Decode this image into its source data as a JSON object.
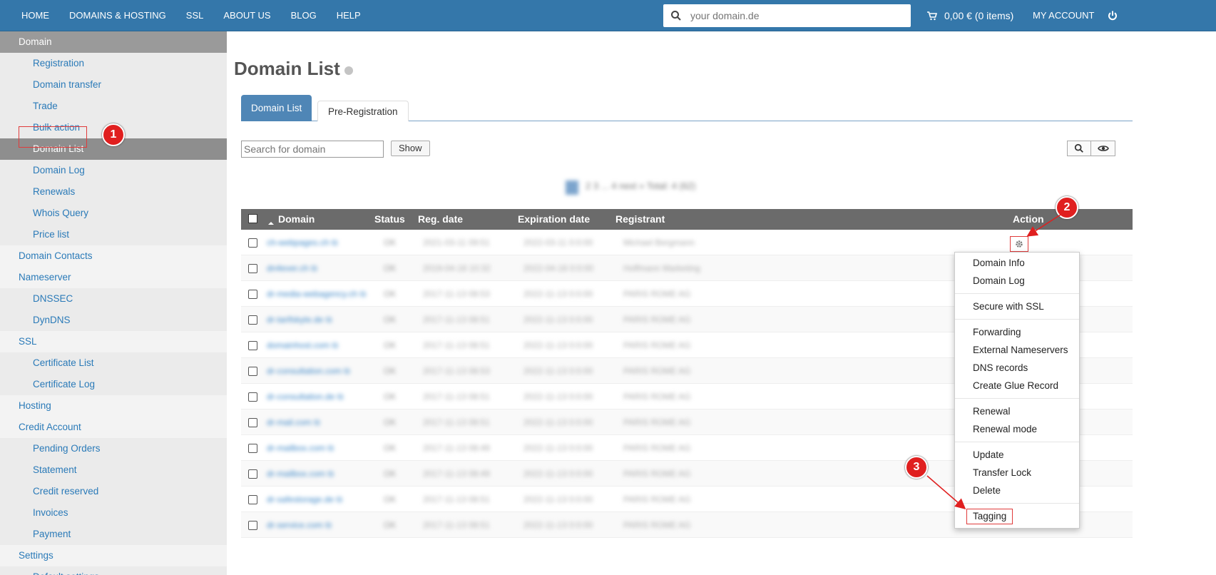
{
  "nav": {
    "items": [
      "HOME",
      "DOMAINS & HOSTING",
      "SSL",
      "ABOUT US",
      "BLOG",
      "HELP"
    ],
    "search_placeholder": "your domain.de",
    "cart": "0,00 € (0 items)",
    "my_account": "MY ACCOUNT"
  },
  "sidebar": {
    "items": [
      {
        "label": "Domain",
        "level": 1,
        "state": "head"
      },
      {
        "label": "Registration",
        "level": 2
      },
      {
        "label": "Domain transfer",
        "level": 2
      },
      {
        "label": "Trade",
        "level": 2
      },
      {
        "label": "Bulk action",
        "level": 2
      },
      {
        "label": "Domain List",
        "level": 2,
        "state": "active"
      },
      {
        "label": "Domain Log",
        "level": 2
      },
      {
        "label": "Renewals",
        "level": 2
      },
      {
        "label": "Whois Query",
        "level": 2
      },
      {
        "label": "Price list",
        "level": 2
      },
      {
        "label": "Domain Contacts",
        "level": 1
      },
      {
        "label": "Nameserver",
        "level": 1
      },
      {
        "label": "DNSSEC",
        "level": 2
      },
      {
        "label": "DynDNS",
        "level": 2
      },
      {
        "label": "SSL",
        "level": 1
      },
      {
        "label": "Certificate List",
        "level": 2
      },
      {
        "label": "Certificate Log",
        "level": 2
      },
      {
        "label": "Hosting",
        "level": 1
      },
      {
        "label": "Credit Account",
        "level": 1
      },
      {
        "label": "Pending Orders",
        "level": 2
      },
      {
        "label": "Statement",
        "level": 2
      },
      {
        "label": "Credit reserved",
        "level": 2
      },
      {
        "label": "Invoices",
        "level": 2
      },
      {
        "label": "Payment",
        "level": 2
      },
      {
        "label": "Settings",
        "level": 1
      },
      {
        "label": "Default settings",
        "level": 2
      }
    ]
  },
  "page": {
    "title": "Domain List",
    "tabs": [
      "Domain List",
      "Pre-Registration"
    ],
    "search_placeholder": "Search for domain",
    "show_label": "Show",
    "pager_text": "2 3 ... 4 next » Total: 4 (62)"
  },
  "table": {
    "headers": {
      "domain": "Domain",
      "status": "Status",
      "reg_date": "Reg. date",
      "exp_date": "Expiration date",
      "registrant": "Registrant",
      "action": "Action"
    },
    "rows": [
      {
        "domain": "ch-webpages.ch ⧉",
        "status": "OK",
        "reg": "2021-03-11 09:51",
        "exp": "2022-03-11 0:0:00",
        "registrant": "Michael Bergmann"
      },
      {
        "domain": "dn4ever.ch ⧉",
        "status": "OK",
        "reg": "2019-04-18 10:32",
        "exp": "2022-04-18 0:0:00",
        "registrant": "Hoffmann Marketing"
      },
      {
        "domain": "dr-media-webagency.ch ⧉",
        "status": "OK",
        "reg": "2017-11-13 08:53",
        "exp": "2022-11-13 0:0:00",
        "registrant": "PARIS ROME AG"
      },
      {
        "domain": "dr-tarifskyte.de ⧉",
        "status": "OK",
        "reg": "2017-11-13 08:51",
        "exp": "2022-11-13 0:0:00",
        "registrant": "PARIS ROME AG"
      },
      {
        "domain": "domainhost.com ⧉",
        "status": "OK",
        "reg": "2017-11-13 08:51",
        "exp": "2022-11-13 0:0:00",
        "registrant": "PARIS ROME AG"
      },
      {
        "domain": "dr-consultation.com ⧉",
        "status": "OK",
        "reg": "2017-11-13 08:53",
        "exp": "2022-11-13 0:0:00",
        "registrant": "PARIS ROME AG"
      },
      {
        "domain": "dr-consultation.de ⧉",
        "status": "OK",
        "reg": "2017-11-13 08:51",
        "exp": "2022-11-13 0:0:00",
        "registrant": "PARIS ROME AG"
      },
      {
        "domain": "dr-mail.com ⧉",
        "status": "OK",
        "reg": "2017-11-13 08:51",
        "exp": "2022-11-13 0:0:00",
        "registrant": "PARIS ROME AG"
      },
      {
        "domain": "dr-mailbox.com ⧉",
        "status": "OK",
        "reg": "2017-11-13 08:49",
        "exp": "2022-11-13 0:0:00",
        "registrant": "PARIS ROME AG"
      },
      {
        "domain": "dr-mailbox.com ⧉",
        "status": "OK",
        "reg": "2017-11-13 08:49",
        "exp": "2022-11-13 0:0:00",
        "registrant": "PARIS ROME AG"
      },
      {
        "domain": "dr-safestorage.de ⧉",
        "status": "OK",
        "reg": "2017-11-13 08:51",
        "exp": "2022-11-13 0:0:00",
        "registrant": "PARIS ROME AG"
      },
      {
        "domain": "dr-service.com ⧉",
        "status": "OK",
        "reg": "2017-11-13 08:51",
        "exp": "2022-11-13 0:0:00",
        "registrant": "PARIS ROME AG"
      }
    ]
  },
  "action_menu": {
    "groups": [
      [
        "Domain Info",
        "Domain Log"
      ],
      [
        "Secure with SSL"
      ],
      [
        "Forwarding",
        "External Nameservers",
        "DNS records",
        "Create Glue Record"
      ],
      [
        "Renewal",
        "Renewal mode"
      ],
      [
        "Update",
        "Transfer Lock",
        "Delete"
      ],
      [
        "Tagging"
      ]
    ]
  },
  "annotations": [
    "1",
    "2",
    "3"
  ]
}
